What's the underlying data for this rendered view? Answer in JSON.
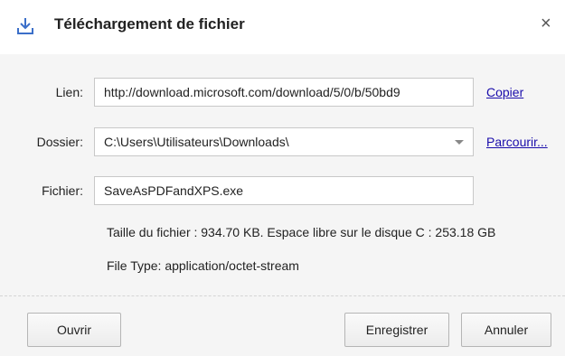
{
  "dialog": {
    "title": "Téléchargement de fichier",
    "close_glyph": "×",
    "icon": "download-icon"
  },
  "form": {
    "link_label": "Lien:",
    "link_value": "http://download.microsoft.com/download/5/0/b/50bd9",
    "copy_label": "Copier",
    "folder_label": "Dossier:",
    "folder_value": "C:\\Users\\Utilisateurs\\Downloads\\",
    "browse_label": "Parcourir...",
    "file_label": "Fichier:",
    "file_value": "SaveAsPDFandXPS.exe"
  },
  "info": {
    "size_line": "Taille du fichier : 934.70 KB. Espace libre sur le disque C : 253.18 GB",
    "type_line": "File Type: application/octet-stream"
  },
  "buttons": {
    "open": "Ouvrir",
    "save": "Enregistrer",
    "cancel": "Annuler"
  },
  "colors": {
    "link": "#1a0dab",
    "accent_icon": "#3b6fc9"
  }
}
